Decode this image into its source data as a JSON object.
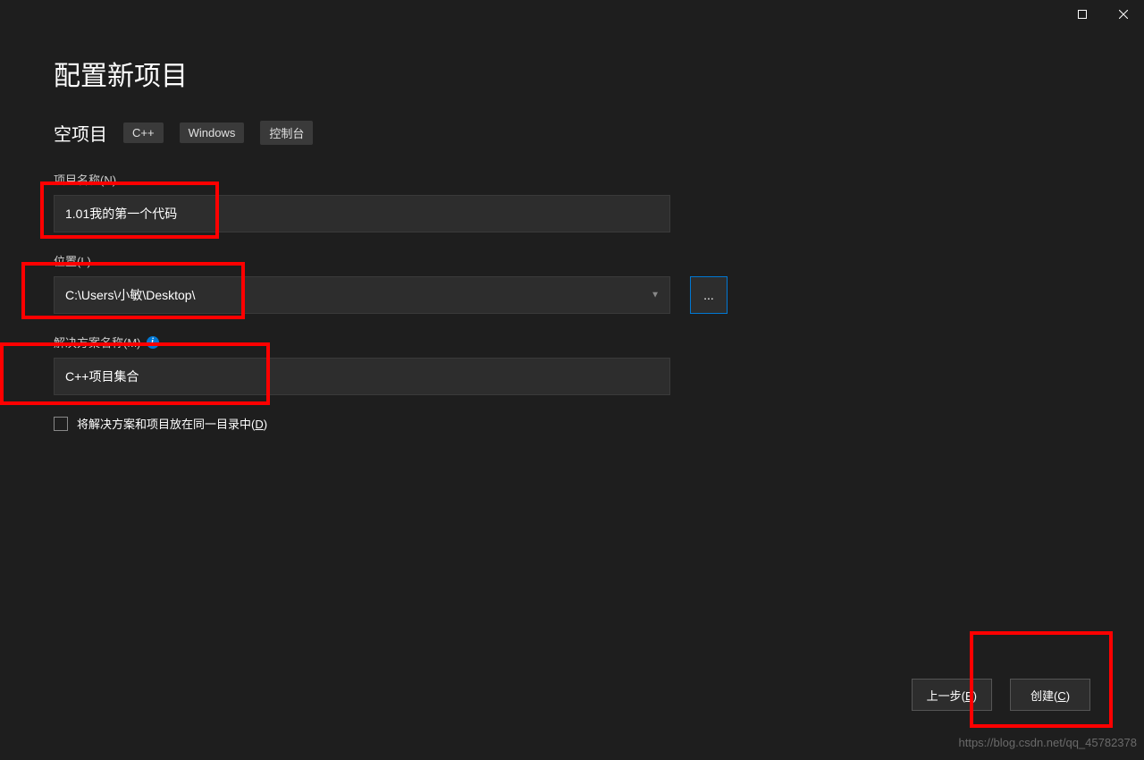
{
  "window_controls": {
    "maximize": "maximize",
    "close": "close"
  },
  "title": "配置新项目",
  "project_type": {
    "name": "空项目",
    "tags": [
      "C++",
      "Windows",
      "控制台"
    ]
  },
  "fields": {
    "project_name": {
      "label": "项目名称(N)",
      "value": "1.01我的第一个代码"
    },
    "location": {
      "label": "位置(L)",
      "value": "C:\\Users\\小敏\\Desktop\\",
      "browse": "..."
    },
    "solution_name": {
      "label": "解决方案名称(M)",
      "value": "C++项目集合"
    },
    "same_directory": {
      "label_prefix": "将解决方案和项目放在同一目录中(",
      "label_key": "D",
      "label_suffix": ")",
      "checked": false
    }
  },
  "footer": {
    "back_prefix": "上一步(",
    "back_key": "B",
    "back_suffix": ")",
    "create_prefix": "创建(",
    "create_key": "C",
    "create_suffix": ")"
  },
  "watermark": "https://blog.csdn.net/qq_45782378"
}
